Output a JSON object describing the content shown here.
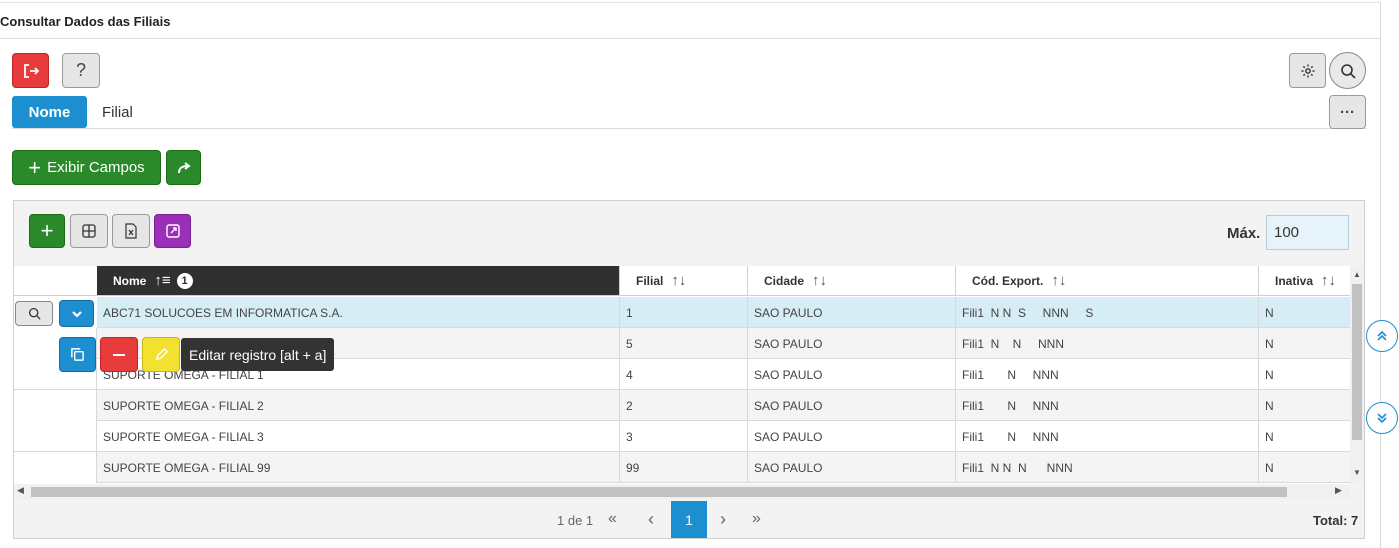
{
  "page": {
    "title": "Consultar Dados das Filiais"
  },
  "toolbar": {
    "exit_icon": "exit-icon",
    "help_label": "?",
    "settings_icon": "gear-icon",
    "search_icon": "search-icon",
    "more_label": "···"
  },
  "tabs": [
    {
      "label": "Nome",
      "active": true
    },
    {
      "label": "Filial",
      "active": false
    }
  ],
  "actions": {
    "show_fields_label": "Exibir Campos",
    "plus_glyph": "+",
    "share_icon": "share-icon"
  },
  "grid_toolbar": {
    "max_label": "Máx.",
    "max_value": "100"
  },
  "columns": [
    {
      "label": "Nome",
      "sort_badge": "1"
    },
    {
      "label": "Filial"
    },
    {
      "label": "Cidade"
    },
    {
      "label": "Cód. Export."
    },
    {
      "label": "Inativa"
    }
  ],
  "rows": [
    {
      "nome": "ABC71 SOLUCOES EM INFORMATICA S.A.",
      "filial": "1",
      "cidade": "SAO PAULO",
      "cod": "Fili1  N N  S     NNN     S",
      "inativa": "N",
      "selected": true
    },
    {
      "nome": "",
      "filial": "5",
      "cidade": "SAO PAULO",
      "cod": "Fili1  N    N     NNN",
      "inativa": "N"
    },
    {
      "nome": "SUPORTE OMEGA - FILIAL 1",
      "filial": "4",
      "cidade": "SAO PAULO",
      "cod": "Fili1       N     NNN",
      "inativa": "N"
    },
    {
      "nome": "SUPORTE OMEGA - FILIAL 2",
      "filial": "2",
      "cidade": "SAO PAULO",
      "cod": "Fili1       N     NNN",
      "inativa": "N"
    },
    {
      "nome": "SUPORTE OMEGA - FILIAL 3",
      "filial": "3",
      "cidade": "SAO PAULO",
      "cod": "Fili1       N     NNN",
      "inativa": "N"
    },
    {
      "nome": "SUPORTE OMEGA - FILIAL 99",
      "filial": "99",
      "cidade": "SAO PAULO",
      "cod": "Fili1  N N  N      NNN",
      "inativa": "N"
    }
  ],
  "tooltip": "Editar registro [alt + a]",
  "pagination": {
    "info": "1 de 1",
    "first": "«",
    "prev": "‹",
    "current": "1",
    "next": "›",
    "last": "»"
  },
  "total": "Total: 7",
  "colors": {
    "accent": "#1b8fd0",
    "danger": "#e83b3b",
    "success": "#2a8a2a",
    "purple": "#9b2fb8",
    "warning": "#f2e12f"
  }
}
